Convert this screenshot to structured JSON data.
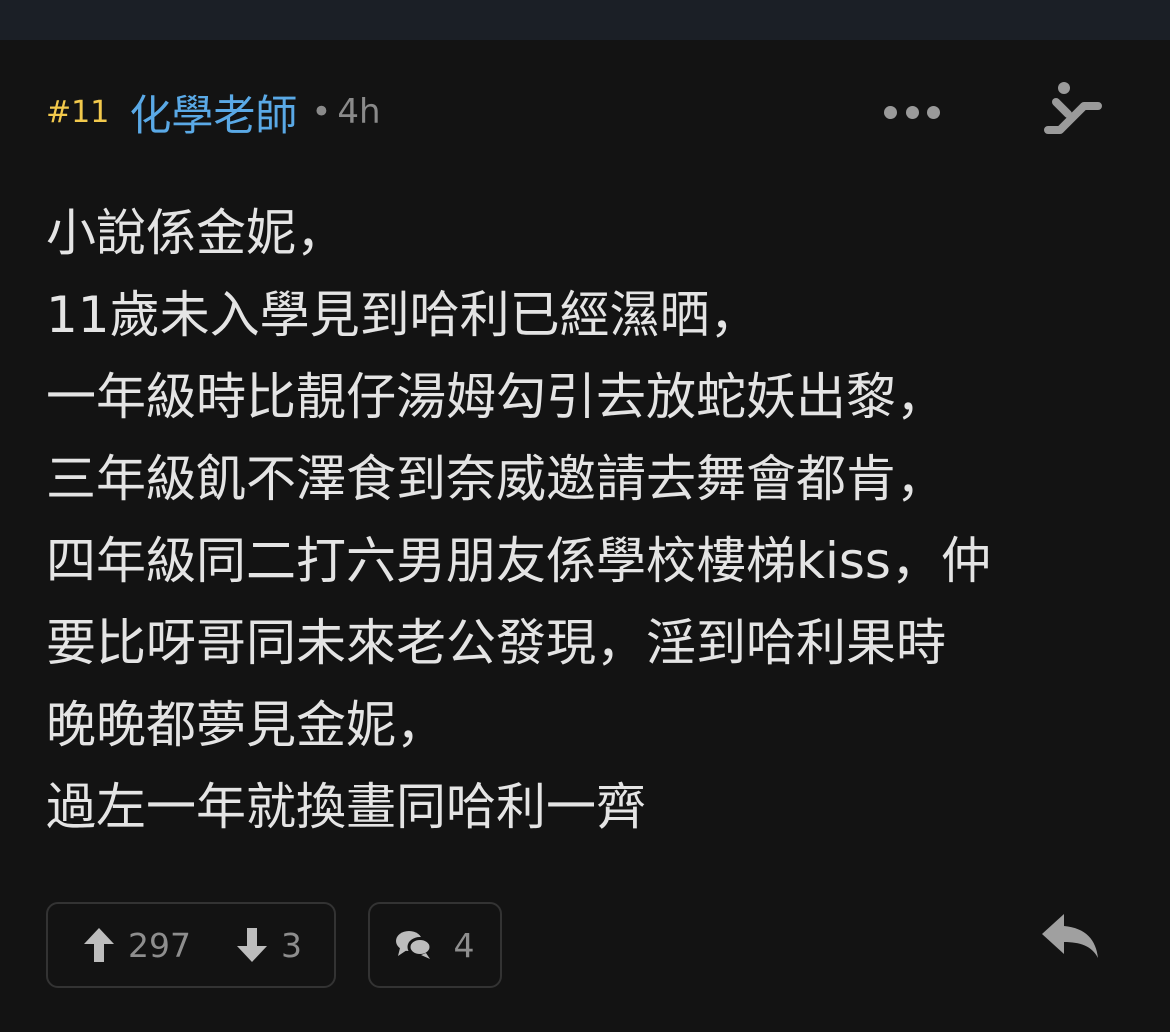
{
  "post": {
    "floor": "#11",
    "author": "化學老師",
    "separator": "•",
    "time": "4h",
    "content_lines": [
      "小說係金妮，",
      "11歲未入學見到哈利已經濕晒，",
      "一年級時比靚仔湯姆勾引去放蛇妖出黎，",
      "三年級飢不澤食到奈威邀請去舞會都肯，",
      "四年級同二打六男朋友係學校樓梯kiss，仲",
      "要比呀哥同未來老公發現，淫到哈利果時",
      "晚晚都夢見金妮，",
      "過左一年就換畫同哈利一齊"
    ],
    "upvotes": "297",
    "downvotes": "3",
    "comments": "4"
  },
  "icons": {
    "more": "more-dots-icon",
    "escalator": "escalator-icon",
    "upvote": "arrow-up-icon",
    "downvote": "arrow-down-icon",
    "comment": "comment-bubbles-icon",
    "reply": "reply-arrow-icon"
  },
  "colors": {
    "background": "#131313",
    "topbar": "#1b1f26",
    "floor": "#f2c94c",
    "author": "#5aa9e6",
    "text": "#e4e4e4",
    "muted": "#8e8e8e"
  }
}
